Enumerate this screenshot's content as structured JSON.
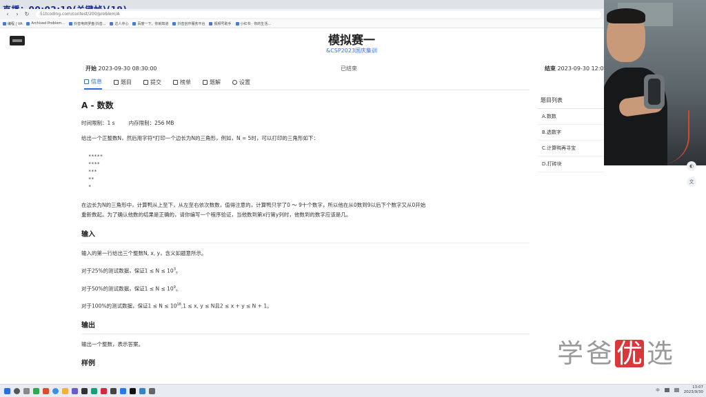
{
  "overlay": {
    "recording": "直播：00:02:19(关键帧)(19)"
  },
  "browser": {
    "url": "51tcoding.com/contest/200/problem/A",
    "bookmarks": [
      "编程 | VA",
      "Archived Problem...",
      "抖音电商罗盘·抖音...",
      "达人中心",
      "百度一下，你就知道",
      "抖音创作服务平台",
      "视频号助手",
      "小红书 · 你的生活..."
    ]
  },
  "header": {
    "title": "模拟赛一",
    "subtitle": "&CSP2023国庆集训",
    "start_label": "开始",
    "start_time": "2023-09-30 08:30:00",
    "status": "已结束",
    "end_label": "结束",
    "end_time": "2023-09-30 12:0"
  },
  "tabs": [
    {
      "label": "信息",
      "icon": "home-icon",
      "active": true
    },
    {
      "label": "题目",
      "icon": "list-icon",
      "active": false
    },
    {
      "label": "提交",
      "icon": "doc-icon",
      "active": false
    },
    {
      "label": "榜单",
      "icon": "ranking-icon",
      "active": false
    },
    {
      "label": "题解",
      "icon": "book-icon",
      "active": false
    },
    {
      "label": "设置",
      "icon": "gear-icon",
      "active": false
    }
  ],
  "problem": {
    "title": "A - 数数",
    "time_limit": "时间限制：1 s",
    "mem_limit": "内存限制：256 MB",
    "desc1": "给出一个正整数N，然后用字符*打印一个边长为N的三角形，例如，N = 5时，可以打印的三角形如下：",
    "stars": [
      "*****",
      "****",
      "***",
      "**",
      "*"
    ],
    "desc2": "在边长为N的三角形中，计算鸭从上至下，从左至右依次数数，值得注意的，计算鸭只学了0 ～ 9十个数字，所以他在从0数到9以后下个数字又从0开始",
    "desc3": "重新数起。为了确认他数的结果是正确的，请你编写一个程序验证，当他数到第x行第y列时，他数到的数字应该是几。",
    "input_title": "输入",
    "input_desc": "输入的第一行给出三个整数N, x, y，含义如题意所示。",
    "cond1": "对于25%的测试数据，保证1 ≤ N ≤ 10",
    "cond1_exp": "3",
    "cond2": "对于50%的测试数据，保证1 ≤ N ≤ 10",
    "cond2_exp": "9",
    "cond3_a": "对于100%的测试数据，保证1 ≤ N ≤ 10",
    "cond3_exp": "18",
    "cond3_b": ",1 ≤ x, y ≤ N且2 ≤ x + y ≤ N + 1。",
    "output_title": "输出",
    "output_desc": "输出一个整数，表示答案。",
    "sample_title": "样例"
  },
  "sidebar": {
    "title": "题目列表",
    "items": [
      "A.数数",
      "B.选数字",
      "C.计算鸭再寻宝",
      "D.打砖块"
    ]
  },
  "watermark": [
    "学",
    "爸",
    "优",
    "选"
  ],
  "taskbar": {
    "ime": "中",
    "clock_time": "13:07",
    "clock_date": "2023/9/30"
  }
}
